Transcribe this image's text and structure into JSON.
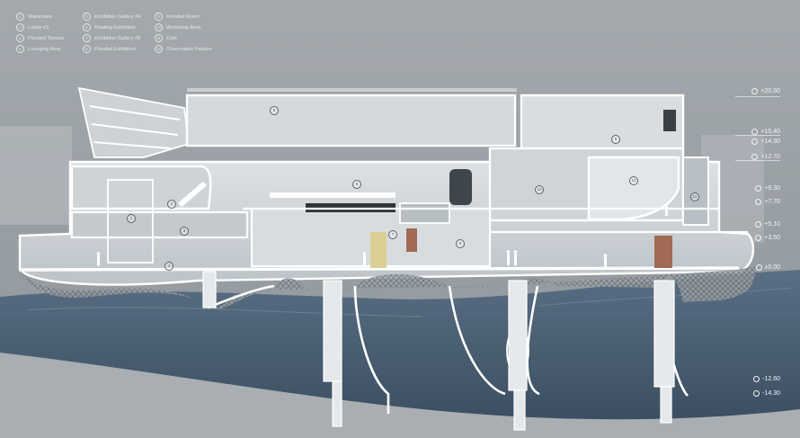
{
  "legend": [
    {
      "num": "1",
      "label": "Waremans"
    },
    {
      "num": "2",
      "label": "Lobby #3"
    },
    {
      "num": "3",
      "label": "Flooded Terrace"
    },
    {
      "num": "4",
      "label": "Lounging Area"
    },
    {
      "num": "5",
      "label": "Exhibition Gallery #4"
    },
    {
      "num": "6",
      "label": "Floating Exhibition"
    },
    {
      "num": "7",
      "label": "Exhibition Gallery #5"
    },
    {
      "num": "8",
      "label": "Flooded Exhibition"
    },
    {
      "num": "9",
      "label": "Flooded Room"
    },
    {
      "num": "10",
      "label": "Workshop Area"
    },
    {
      "num": "11",
      "label": "Café"
    },
    {
      "num": "12",
      "label": "Observation Pasture"
    }
  ],
  "levels": [
    "+20.50",
    "+15.40",
    "+14.30",
    "+12.70",
    "+9.30",
    "+7.70",
    "+5.10",
    "+3.50",
    "±0.00",
    "-12.60",
    "-14.30"
  ],
  "room_markers": [
    "1",
    "2",
    "3",
    "4",
    "5",
    "6",
    "7",
    "8",
    "9",
    "10",
    "11",
    "12"
  ],
  "colors": {
    "background": "#9da3a8",
    "water": "#4f6478",
    "concrete": "#e7eaec",
    "accent_yellow": "#dccf95",
    "accent_rust": "#a06a55"
  }
}
